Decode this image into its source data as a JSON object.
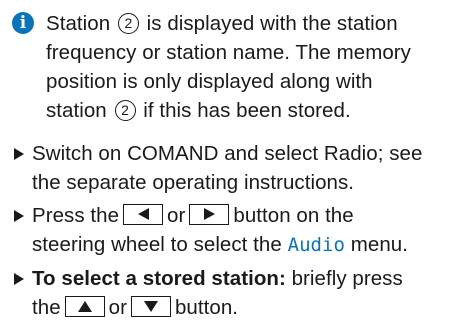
{
  "note": {
    "icon": "info-icon",
    "accent_color": "#0a74b9",
    "circled_number": "2",
    "lines": [
      {
        "before": "Station ",
        "after": " is displayed with the station"
      },
      {
        "text": "frequency or station name. The memory"
      },
      {
        "text": "position is only displayed along with"
      },
      {
        "before": "station ",
        "after": " if this has been stored."
      }
    ]
  },
  "steps": [
    {
      "line1": "Switch on COMAND and select Radio; see",
      "line2": "the separate operating instructions."
    },
    {
      "line1_a": "Press the",
      "line1_b": "or",
      "line1_c": "button on the",
      "button_left_icon": "left-arrow-icon",
      "button_right_icon": "right-arrow-icon",
      "line2_a": "steering wheel to select the ",
      "menu_name": "Audio",
      "line2_b": " menu."
    },
    {
      "bold_lead": "To select a stored station:",
      "line1_rest": " briefly press",
      "line2_a": "the",
      "line2_b": "or",
      "line2_c": "button.",
      "button_up_icon": "up-arrow-icon",
      "button_down_icon": "down-arrow-icon"
    }
  ]
}
